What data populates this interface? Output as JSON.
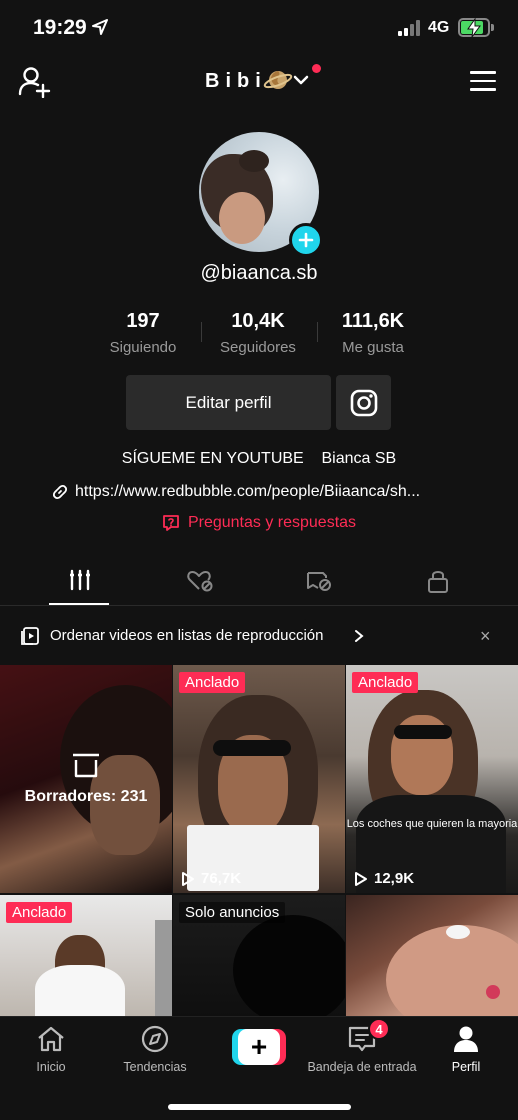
{
  "status_bar": {
    "time": "19:29",
    "network": "4G"
  },
  "header": {
    "username": "Bibi"
  },
  "profile": {
    "handle": "@biaanca.sb",
    "stats": [
      {
        "value": "197",
        "label": "Siguiendo"
      },
      {
        "value": "10,4K",
        "label": "Seguidores"
      },
      {
        "value": "111,6K",
        "label": "Me gusta"
      }
    ],
    "edit_label": "Editar perfil",
    "bio": "SÍGUEME EN YOUTUBE    Bianca SB",
    "link": "https://www.redbubble.com/people/Biiaanca/sh...",
    "qa_label": "Preguntas y respuestas"
  },
  "playlist_banner": {
    "text": "Ordenar videos en listas de reproducción",
    "close": "×"
  },
  "grid": {
    "drafts_label": "Borradores: 231",
    "items": [
      {
        "badge": "",
        "views": ""
      },
      {
        "badge": "Anclado",
        "views": "76,7K"
      },
      {
        "badge": "Anclado",
        "views": "12,9K",
        "caption": "Los coches que quieren la mayoria"
      },
      {
        "badge": "Anclado",
        "views": ""
      },
      {
        "badge": "Solo anuncios",
        "views": ""
      },
      {
        "badge": "",
        "views": ""
      }
    ]
  },
  "bottom_nav": {
    "home": "Inicio",
    "trends": "Tendencias",
    "inbox": "Bandeja de entrada",
    "inbox_count": "4",
    "profile": "Perfil"
  },
  "colors": {
    "accent": "#fe2c55",
    "cyan": "#20d5ec",
    "background": "#121212"
  }
}
